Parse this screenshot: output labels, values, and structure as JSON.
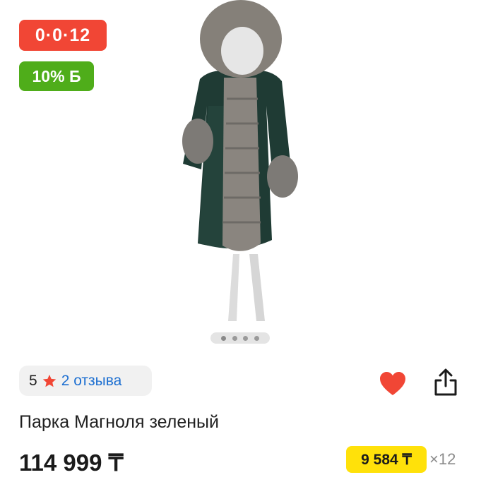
{
  "badges": {
    "installment": "0·0·12",
    "bonus": "10% Б"
  },
  "gallery": {
    "image_icon": "parka-photo",
    "pages": 4,
    "current_page": 1
  },
  "rating": {
    "score": "5",
    "reviews_label": "2 отзыва",
    "star_color": "#f14635"
  },
  "actions": {
    "favorite_icon": "heart-icon",
    "share_icon": "share-icon",
    "favorite_color": "#f14635"
  },
  "product": {
    "title": "Парка Магноля зеленый",
    "price": "114 999 ₸"
  },
  "installment": {
    "monthly": "9 584 ₸",
    "multiplier": "×12"
  }
}
